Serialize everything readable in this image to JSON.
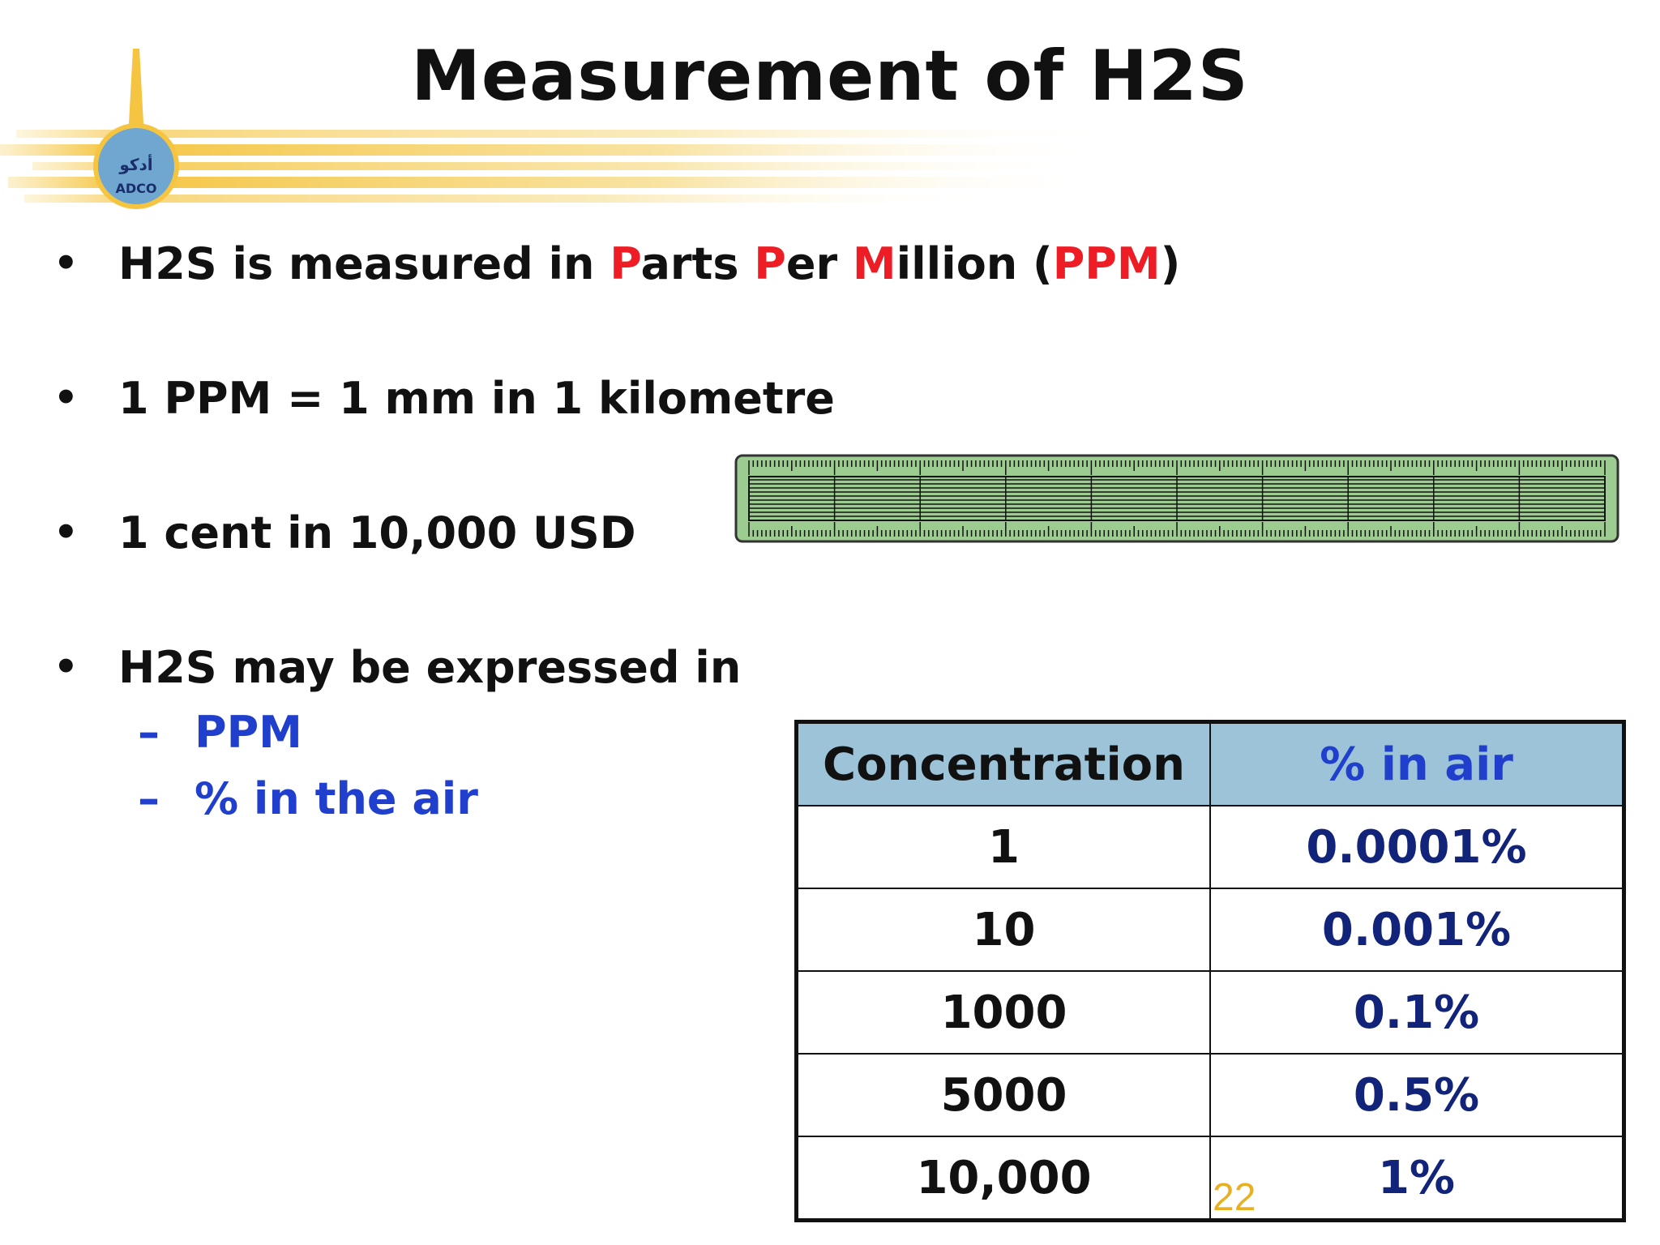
{
  "slide": {
    "title": "Measurement of H2S",
    "logo_text": "ADCO",
    "logo_arabic": "أدكو",
    "page_number": "22"
  },
  "bullets": [
    {
      "segments": [
        {
          "text": "H2S is measured in ",
          "color": "default"
        },
        {
          "text": "P",
          "color": "red"
        },
        {
          "text": "arts ",
          "color": "default"
        },
        {
          "text": "P",
          "color": "red"
        },
        {
          "text": "er ",
          "color": "default"
        },
        {
          "text": "M",
          "color": "red"
        },
        {
          "text": "illion (",
          "color": "default"
        },
        {
          "text": "PPM",
          "color": "red"
        },
        {
          "text": ")",
          "color": "default"
        }
      ]
    },
    {
      "text": "1 PPM = 1 mm in 1 kilometre"
    },
    {
      "text": "1 cent in 10,000 USD"
    },
    {
      "text": "H2S may be expressed in"
    }
  ],
  "sub_bullets": [
    {
      "dash": "–",
      "text": "PPM"
    },
    {
      "dash": "–",
      "text": "% in the air"
    }
  ],
  "table": {
    "headers": [
      "Concentration",
      "% in air"
    ],
    "rows": [
      [
        "1",
        "0.0001%"
      ],
      [
        "10",
        "0.001%"
      ],
      [
        "1000",
        "0.1%"
      ],
      [
        "5000",
        "0.5%"
      ],
      [
        "10,000",
        "1%"
      ]
    ]
  },
  "colors": {
    "accent_red": "#ee1c24",
    "accent_blue": "#1f3fcc",
    "table_header": "#9cc3d8",
    "table_value": "#12247a",
    "ruler_green": "#9ccc8f",
    "swoosh_gold": "#f5c542",
    "page_number": "#e8b020"
  },
  "icons": {
    "logo": "adco-logo-icon",
    "ruler": "ruler-icon"
  }
}
